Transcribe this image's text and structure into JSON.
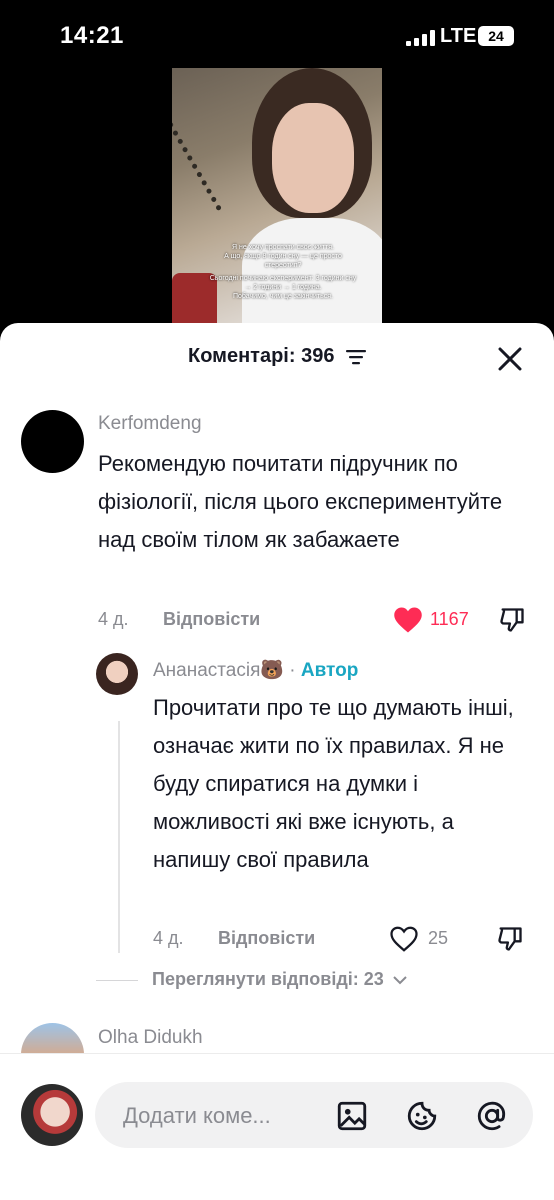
{
  "status": {
    "time": "14:21",
    "network": "LTE",
    "battery": "24"
  },
  "video": {
    "overlay_line1": "Я не хочу проспати своє життя.",
    "overlay_line2": "А що, якщо 8 годин сну — це просто стереотип?",
    "overlay_line3": "Сьогодні починаю експеримент: 3 години сну → 2 години → 1 година.",
    "overlay_line4": "Побачимо, чим це закінчиться."
  },
  "sheet": {
    "title": "Коментарі: 396"
  },
  "comments": [
    {
      "username": "Kerfomdeng",
      "text": "Рекомендую почитати підручник по фізіології, після цього експериментуйте над своїм тілом як забажаете",
      "age": "4 д.",
      "reply_label": "Відповісти",
      "likes": "1167"
    },
    {
      "username": "Ананастасія🐻",
      "author_badge": "Автор",
      "separator": "·",
      "text": "Прочитати про те що думають інші, означає жити по їх правилах. Я не буду спиратися на думки і можливості які вже існують, а напишу свої правила",
      "age": "4 д.",
      "reply_label": "Відповісти",
      "likes": "25"
    },
    {
      "username": "Olha  Didukh"
    }
  ],
  "view_replies": "Переглянути відповіді: 23",
  "composer": {
    "placeholder": "Додати коме..."
  },
  "colors": {
    "heart_active": "#fe2c55",
    "author": "#1aa6c2",
    "text": "#161823",
    "muted": "#8a8b91"
  }
}
